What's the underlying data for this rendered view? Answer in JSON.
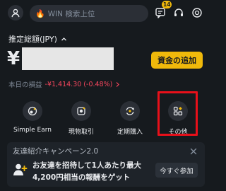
{
  "header": {
    "search_placeholder": "WIN 検索上位",
    "notification_count": "14",
    "icons": [
      "profile-icon",
      "fire-icon",
      "message-icon",
      "headset-icon",
      "coin-icon"
    ]
  },
  "balance": {
    "label": "推定総額(JPY)",
    "currency_symbol": "¥",
    "deposit_label": "資金の追加",
    "pnl_label": "本日の損益",
    "pnl_value": "-¥1,414.30 (-0.48%)"
  },
  "actions": [
    {
      "label": "Simple Earn",
      "icon": "earn-icon"
    },
    {
      "label": "現物取引",
      "icon": "spot-trade-icon"
    },
    {
      "label": "定期購入",
      "icon": "recurring-buy-icon"
    },
    {
      "label": "その他",
      "icon": "more-grid-icon"
    }
  ],
  "referral": {
    "title": "友達紹介キャンペーン2.0",
    "line1": "お友達を招待して1人あたり最大",
    "line2": "4,200円相当の報酬をゲット",
    "cta": "今すぐ参加"
  },
  "colors": {
    "background": "#161a1e",
    "accent": "#f0b90b",
    "negative": "#f6465d",
    "highlight": "#e8101a"
  }
}
